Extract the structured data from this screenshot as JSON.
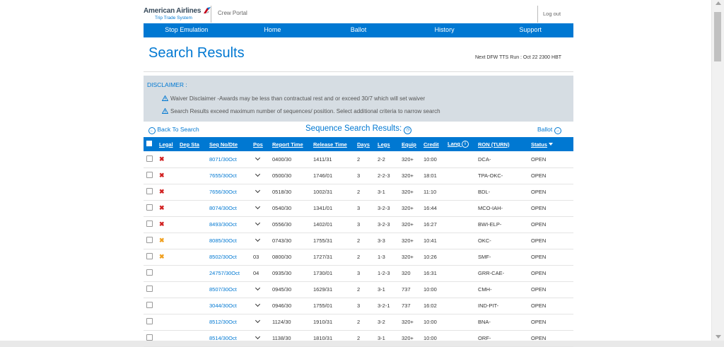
{
  "header": {
    "logo_brand": "American Airlines",
    "logo_sub": "Trip Trade System",
    "portal": "Crew Portal",
    "logout": "Log out"
  },
  "nav": [
    "Stop Emulation",
    "Home",
    "Ballot",
    "History",
    "Support"
  ],
  "page_title": "Search Results",
  "next_run": "Next DFW TTS Run : Oct 22 2300 HBT",
  "disclaimer": {
    "heading": "DISCLAIMER :",
    "lines": [
      "Waiver Disclaimer -Awards may be less than contractual rest and or exceed 30/7 which will set waiver",
      "Search Results exceed maximum number of sequences/ position. Select additional criteria to narrow search"
    ]
  },
  "actions": {
    "back": "Back To Search",
    "results_title": "Sequence Search Results:",
    "ballot": "Ballot"
  },
  "table": {
    "columns": [
      "Legal",
      "Dep Sta",
      "Seq No/Dte",
      "Pos",
      "Report Time",
      "Release Time",
      "Days",
      "Legs",
      "Equip",
      "Credit",
      "Lang",
      "RON (TURN)",
      "Status"
    ],
    "rows": [
      {
        "legal": "x-red",
        "seq": "8071/30Oct",
        "pos": "",
        "report": "0400/30",
        "release": "1411/31",
        "days": "2",
        "legs": "2-2",
        "equip": "320+",
        "credit": "10:00",
        "lang": "",
        "ron": "DCA-",
        "status": "OPEN"
      },
      {
        "legal": "x-red",
        "seq": "7655/30Oct",
        "pos": "",
        "report": "0500/30",
        "release": "1746/01",
        "days": "3",
        "legs": "2-2-3",
        "equip": "320+",
        "credit": "18:01",
        "lang": "",
        "ron": "TPA-OKC-",
        "status": "OPEN"
      },
      {
        "legal": "x-red",
        "seq": "7656/30Oct",
        "pos": "",
        "report": "0518/30",
        "release": "1002/31",
        "days": "2",
        "legs": "3-1",
        "equip": "320+",
        "credit": "11:10",
        "lang": "",
        "ron": "BDL-",
        "status": "OPEN"
      },
      {
        "legal": "x-red",
        "seq": "8074/30Oct",
        "pos": "",
        "report": "0540/30",
        "release": "1341/01",
        "days": "3",
        "legs": "3-2-3",
        "equip": "320+",
        "credit": "16:44",
        "lang": "",
        "ron": "MCO-IAH-",
        "status": "OPEN"
      },
      {
        "legal": "x-red",
        "seq": "8493/30Oct",
        "pos": "",
        "report": "0556/30",
        "release": "1402/01",
        "days": "3",
        "legs": "3-2-3",
        "equip": "320+",
        "credit": "16:27",
        "lang": "",
        "ron": "BWI-ELP-",
        "status": "OPEN"
      },
      {
        "legal": "x-amber",
        "seq": "8085/30Oct",
        "pos": "",
        "report": "0743/30",
        "release": "1755/31",
        "days": "2",
        "legs": "3-3",
        "equip": "320+",
        "credit": "10:41",
        "lang": "",
        "ron": "OKC-",
        "status": "OPEN"
      },
      {
        "legal": "x-amber",
        "seq": "8502/30Oct",
        "pos": "03",
        "report": "0800/30",
        "release": "1727/31",
        "days": "2",
        "legs": "1-3",
        "equip": "320+",
        "credit": "10:26",
        "lang": "",
        "ron": "SMF-",
        "status": "OPEN"
      },
      {
        "legal": "",
        "seq": "24757/30Oct",
        "pos": "04",
        "report": "0935/30",
        "release": "1730/01",
        "days": "3",
        "legs": "1-2-3",
        "equip": "320",
        "credit": "16:31",
        "lang": "",
        "ron": "GRR-CAE-",
        "status": "OPEN"
      },
      {
        "legal": "",
        "seq": "8507/30Oct",
        "pos": "",
        "report": "0945/30",
        "release": "1629/31",
        "days": "2",
        "legs": "3-1",
        "equip": "737",
        "credit": "10:00",
        "lang": "",
        "ron": "CMH-",
        "status": "OPEN"
      },
      {
        "legal": "",
        "seq": "3044/30Oct",
        "pos": "",
        "report": "0946/30",
        "release": "1755/01",
        "days": "3",
        "legs": "3-2-1",
        "equip": "737",
        "credit": "16:02",
        "lang": "",
        "ron": "IND-PIT-",
        "status": "OPEN"
      },
      {
        "legal": "",
        "seq": "8512/30Oct",
        "pos": "",
        "report": "1124/30",
        "release": "1910/31",
        "days": "2",
        "legs": "3-2",
        "equip": "320+",
        "credit": "10:00",
        "lang": "",
        "ron": "BNA-",
        "status": "OPEN"
      },
      {
        "legal": "",
        "seq": "8514/30Oct",
        "pos": "",
        "report": "1138/30",
        "release": "1810/31",
        "days": "2",
        "legs": "3-1",
        "equip": "320+",
        "credit": "10:00",
        "lang": "",
        "ron": "ORF-",
        "status": "OPEN"
      }
    ]
  },
  "colors": {
    "primary": "#0078d2",
    "disclaimer_bg": "#d6dde3",
    "illegal": "#d12121",
    "warning": "#f0a020"
  }
}
